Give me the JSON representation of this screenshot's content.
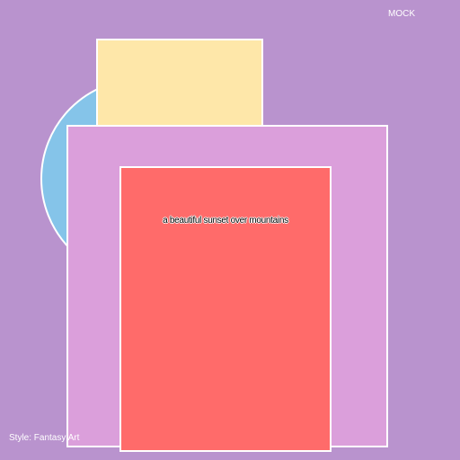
{
  "watermark": {
    "text": "MOCK"
  },
  "caption": {
    "prompt": "a beautiful sunset over mountains"
  },
  "footer": {
    "style_label": "Style: Fantasy Art"
  },
  "colors": {
    "background": "#B993CE",
    "circle": "#85C4E9",
    "yellow": "#FEE7A9",
    "pink": "#DB9FDB",
    "red": "#FF6B6A",
    "stroke": "#FFFFFF"
  }
}
